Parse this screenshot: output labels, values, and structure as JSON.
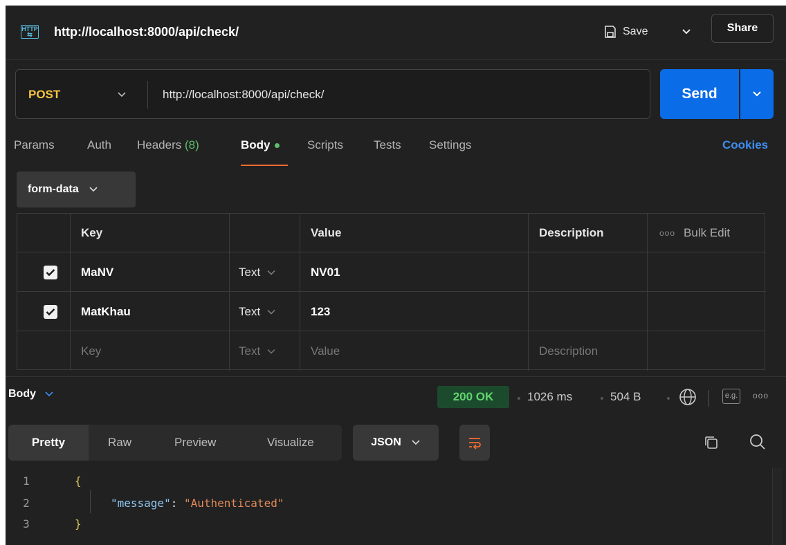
{
  "header": {
    "title": "http://localhost:8000/api/check/",
    "badge_text": "HTTP",
    "save_label": "Save",
    "share_label": "Share"
  },
  "request": {
    "method": "POST",
    "url": "http://localhost:8000/api/check/",
    "send_label": "Send"
  },
  "tabs": {
    "params": "Params",
    "auth": "Auth",
    "headers": "Headers",
    "headers_count": "(8)",
    "body": "Body",
    "scripts": "Scripts",
    "tests": "Tests",
    "settings": "Settings",
    "cookies": "Cookies"
  },
  "body_mode": "form-data",
  "table": {
    "headers": {
      "key": "Key",
      "value": "Value",
      "description": "Description",
      "bulk_edit": "Bulk Edit"
    },
    "rows": [
      {
        "key": "MaNV",
        "type": "Text",
        "value": "NV01",
        "description": ""
      },
      {
        "key": "MatKhau",
        "type": "Text",
        "value": "123",
        "description": ""
      }
    ],
    "placeholder": {
      "key": "Key",
      "type": "Text",
      "value": "Value",
      "description": "Description"
    }
  },
  "response": {
    "section_label": "Body",
    "status": "200 OK",
    "time": "1026 ms",
    "size": "504 B",
    "eg_label": "e.g.",
    "view_tabs": [
      "Pretty",
      "Raw",
      "Preview",
      "Visualize"
    ],
    "format": "JSON",
    "code": {
      "line_numbers": [
        "1",
        "2",
        "3"
      ],
      "open_brace": "{",
      "key": "\"message\"",
      "colon": ": ",
      "value": "\"Authenticated\"",
      "close_brace": "}"
    }
  },
  "colors": {
    "background": "#212121",
    "method": "#f6c442",
    "send": "#0b6ce8",
    "status": "#63d471",
    "accent_tab": "#ee6b2f",
    "link": "#3e8ef0"
  }
}
